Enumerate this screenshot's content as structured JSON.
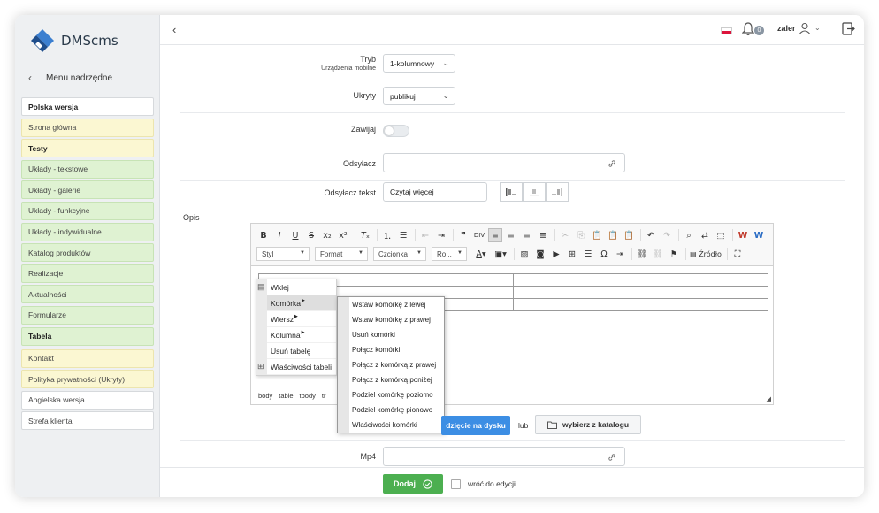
{
  "app": {
    "name": "DMScms"
  },
  "sidebar": {
    "back_label": "Menu nadrzędne",
    "items": [
      {
        "label": "Polska wersja",
        "style": "white bold"
      },
      {
        "label": "Strona główna",
        "style": "yellow"
      },
      {
        "label": "Testy",
        "style": "yellow bold"
      },
      {
        "label": "Układy - tekstowe",
        "style": "green"
      },
      {
        "label": "Układy - galerie",
        "style": "green"
      },
      {
        "label": "Układy - funkcyjne",
        "style": "green"
      },
      {
        "label": "Układy - indywidualne",
        "style": "green"
      },
      {
        "label": "Katalog produktów",
        "style": "green"
      },
      {
        "label": "Realizacje",
        "style": "green"
      },
      {
        "label": "Aktualności",
        "style": "green"
      },
      {
        "label": "Formularze",
        "style": "green"
      },
      {
        "label": "Tabela",
        "style": "green bold"
      },
      {
        "label": "Kontakt",
        "style": "yellow"
      },
      {
        "label": "Polityka prywatności (Ukryty)",
        "style": "yellow"
      },
      {
        "label": "Angielska wersja",
        "style": "white"
      },
      {
        "label": "Strefa klienta",
        "style": "white"
      }
    ]
  },
  "topbar": {
    "notifications_count": "0",
    "username": "zaler"
  },
  "form": {
    "tryb_label": "Tryb",
    "tryb_sublabel": "Urządzenia mobilne",
    "tryb_value": "1-kolumnowy",
    "ukryty_label": "Ukryty",
    "ukryty_value": "publikuj",
    "zawijaj_label": "Zawijaj",
    "odsylacz_label": "Odsyłacz",
    "odsylacz_value": "",
    "odsylacz_tekst_label": "Odsyłacz tekst",
    "odsylacz_tekst_value": "Czytaj więcej",
    "opis_label": "Opis",
    "upload_button": "dzięcie na dysku",
    "or_label": "lub",
    "catalog_button": "wybierz z katalogu",
    "mp4_label": "Mp4",
    "mp4_value": ""
  },
  "editor": {
    "combos": {
      "styl": "Styl",
      "format": "Format",
      "czcionka": "Czcionka",
      "rozmiar": "Ro..."
    },
    "source_label": "Źródło",
    "path": [
      "body",
      "table",
      "tbody",
      "tr"
    ],
    "context_menu": [
      {
        "label": "Wklej",
        "icon": "paste-icon"
      },
      {
        "label": "Komórka",
        "submenu": true
      },
      {
        "label": "Wiersz",
        "submenu": true
      },
      {
        "label": "Kolumna",
        "submenu": true
      },
      {
        "label": "Usuń tabelę"
      },
      {
        "label": "Właściwości tabeli",
        "icon": "table-icon"
      }
    ],
    "cell_submenu": [
      "Wstaw komórkę z lewej",
      "Wstaw komórkę z prawej",
      "Usuń komórki",
      "Połącz komórki",
      "Połącz z komórką z prawej",
      "Połącz z komórką poniżej",
      "Podziel komórkę poziomo",
      "Podziel komórkę pionowo",
      "Właściwości komórki"
    ]
  },
  "footer": {
    "add_button": "Dodaj",
    "return_label": "wróć do edycji"
  },
  "colors": {
    "accent": "#3c8ee4",
    "success": "#4caf50",
    "yellow_item": "#fbf7d2",
    "green_item": "#dff2d2"
  }
}
